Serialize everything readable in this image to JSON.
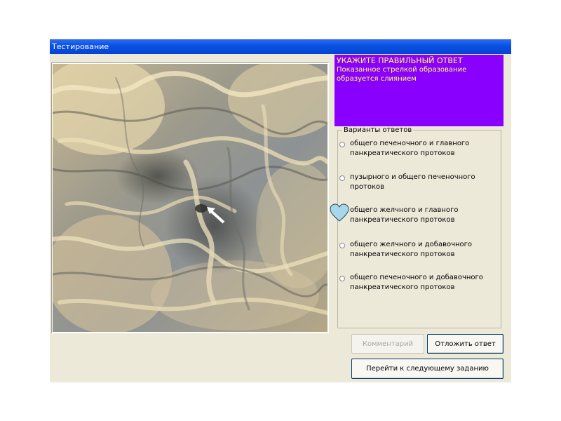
{
  "window": {
    "title": "Тестирование"
  },
  "question": {
    "header": "УКАЖИТЕ ПРАВИЛЬНЫЙ ОТВЕТ",
    "text": "Показанное стрелкой образование образуется слиянием"
  },
  "options": {
    "legend": "Варианты ответов",
    "items": [
      {
        "label": "общего печеночного и главного панкреатического протоков",
        "selected": false
      },
      {
        "label": "пузырного и общего печеночного протоков",
        "selected": false
      },
      {
        "label": "общего желчного и главного панкреатического протоков",
        "selected": true
      },
      {
        "label": "общего желчного и добавочного панкреатического протоков",
        "selected": false
      },
      {
        "label": "общего печеночного и добавочного панкреатического протоков",
        "selected": false
      }
    ]
  },
  "buttons": {
    "comment": "Комментарий",
    "postpone": "Отложить ответ",
    "next": "Перейти к следующему заданию"
  },
  "colors": {
    "title_bar": "#0a4fe0",
    "question_bg": "#8a00ff",
    "question_text": "#ffff66",
    "window_bg": "#ece9d8",
    "heart_fill": "#a6d8ea"
  },
  "icons": {
    "selected_radio": "heart-icon",
    "pointer": "arrow-icon"
  }
}
